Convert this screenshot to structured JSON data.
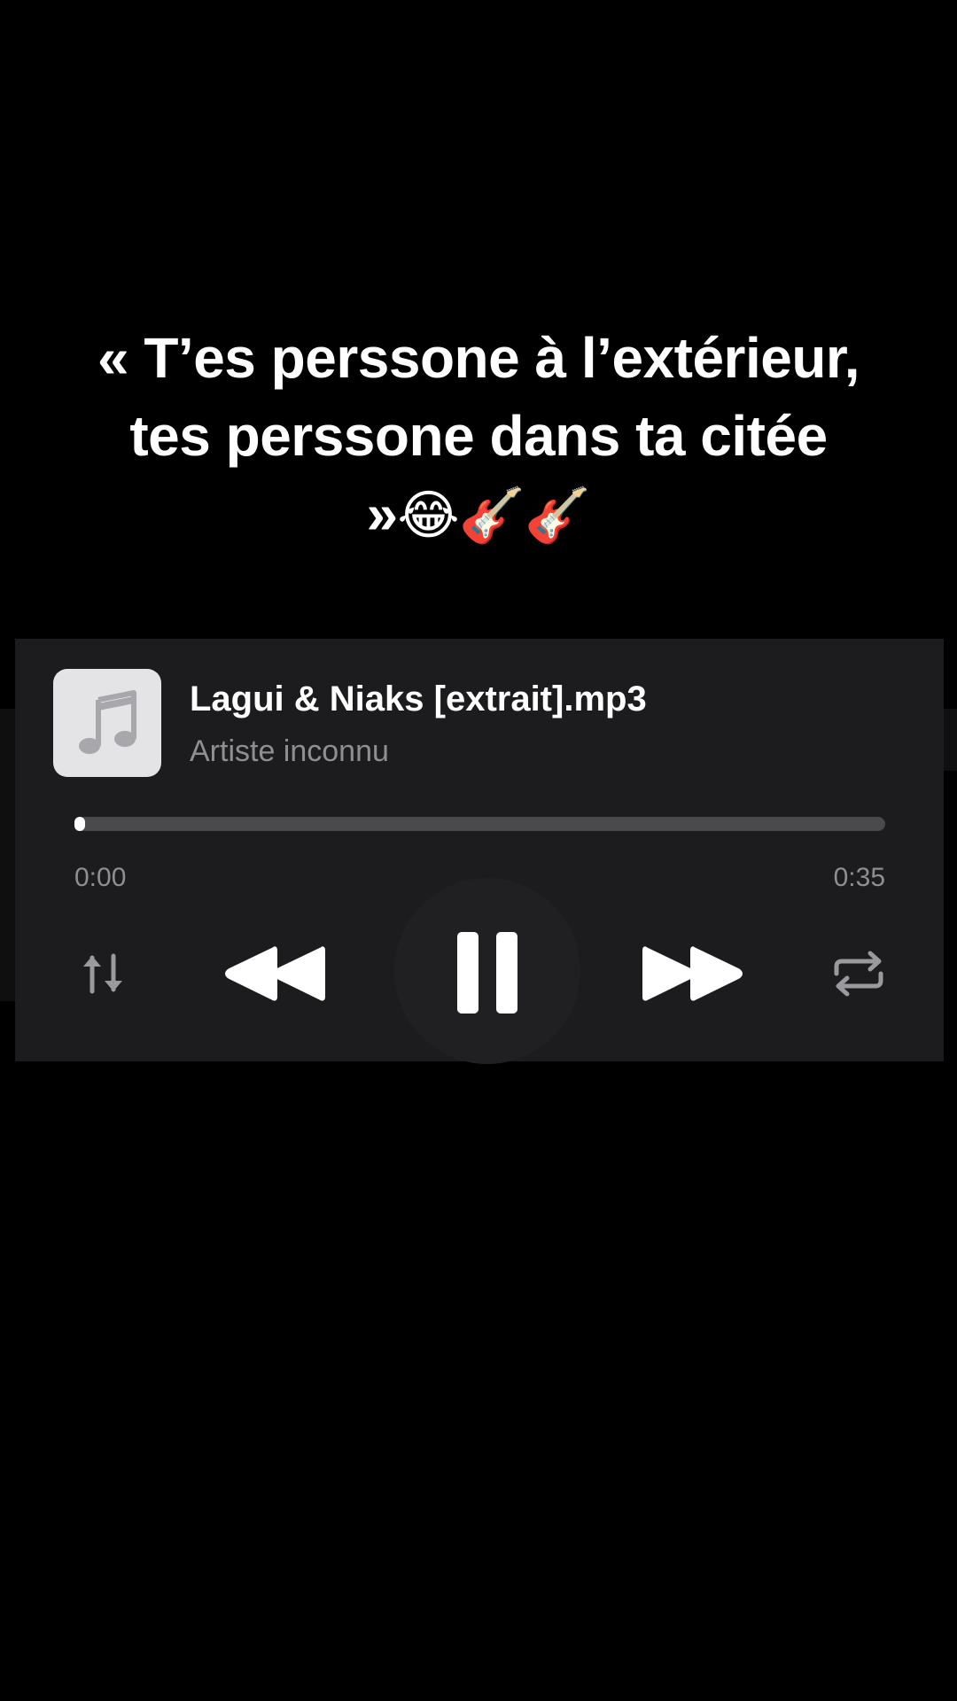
{
  "caption": {
    "text": "« T’es perssone à l’extérieur, tes perssone dans ta citée »",
    "emojis": "😂🎸🎸"
  },
  "player": {
    "track_title": "Lagui & Niaks [extrait].mp3",
    "artist": "Artiste inconnu",
    "artwork_icon": "music-note-icon",
    "progress": 0.0,
    "time_elapsed": "0:00",
    "time_total": "0:35",
    "controls": {
      "sort": "sort-arrows-icon",
      "previous": "rewind-icon",
      "play_pause": "pause-icon",
      "next": "fast-forward-icon",
      "repeat": "repeat-icon"
    }
  },
  "colors": {
    "background": "#000000",
    "panel": "#1c1c1e",
    "text_primary": "#ffffff",
    "text_secondary": "#8e8e93",
    "track": "#4a4a4d",
    "artwork_bg": "#e4e4e6",
    "artwork_note": "#a8a8ac"
  }
}
